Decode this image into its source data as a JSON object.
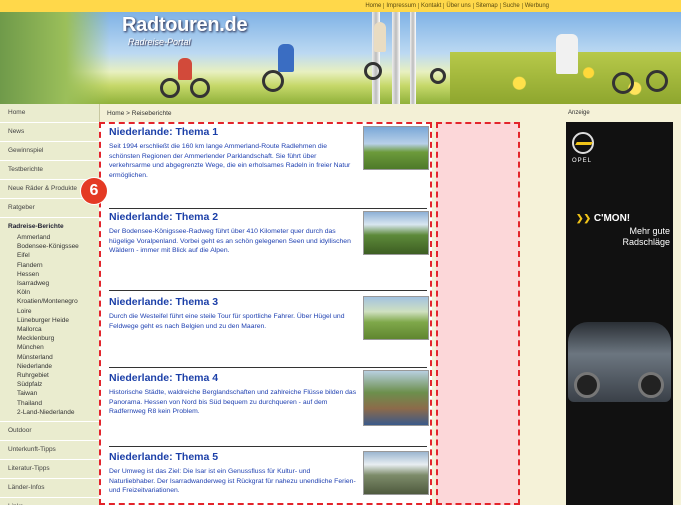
{
  "topnav": [
    "Home",
    "Impressum",
    "Kontakt",
    "Über uns",
    "Sitemap",
    "Suche",
    "Werbung"
  ],
  "header": {
    "logo": "Radtouren.de",
    "tagline": "Radreise-Portal"
  },
  "sidebar": {
    "items_top": [
      "Home",
      "News",
      "Gewinnspiel",
      "Testberichte",
      "Neue Räder & Produkte",
      "Ratgeber"
    ],
    "active_section": "Radreise-Berichte",
    "sub_items": [
      "Ammerland",
      "Bodensee-Königssee",
      "Eifel",
      "Flandern",
      "Hessen",
      "Isarradweg",
      "Köln",
      "Kroatien/Montenegro",
      "Loire",
      "Lüneburger Heide",
      "Mallorca",
      "Mecklenburg",
      "München",
      "Münsterland",
      "Niederlande",
      "Ruhrgebiet",
      "Südpfalz",
      "Taiwan",
      "Thailand",
      "2-Land-Niederlande"
    ],
    "items_bottom": [
      "Outdoor",
      "Unterkunft-Tipps",
      "Literatur-Tipps",
      "Länder-Infos",
      "Links"
    ]
  },
  "breadcrumb": "Home > Reiseberichte",
  "badge": "6",
  "articles": [
    {
      "title": "Niederlande: Thema 1",
      "text": "Seit 1994 erschließt die 160 km lange Ammerland-Route Radlehmen die schönsten Regionen der Ammerlender Parklandschaft. Sie führt über verkehrsarme und abgegrenzte Wege, die ein erholsames Radeln in freier Natur ermöglichen."
    },
    {
      "title": "Niederlande: Thema 2",
      "text": "Der Bodensee-Königssee-Radweg führt über 410 Kilometer quer durch das hügelige Voralpenland. Vorbei geht es an schön gelegenen Seen und idyllischen Wäldern - immer mit Blick auf die Alpen."
    },
    {
      "title": "Niederlande: Thema 3",
      "text": "Durch die Westeifel führt eine steile Tour für sportliche Fahrer. Über Hügel und Feldwege geht es nach Belgien und zu den Maaren."
    },
    {
      "title": "Niederlande: Thema 4",
      "text": "Historische Städte, waldreiche Berglandschaften und zahlreiche Flüsse bilden das Panorama. Hessen von Nord bis Süd bequem zu durchqueren - auf dem Radfernweg R8 kein Problem."
    },
    {
      "title": "Niederlande: Thema 5",
      "text": "Der Umweg ist das Ziel: Die Isar ist ein Genussfluss für Kultur- und Naturliebhaber. Der Isarradwanderweg ist Rückgrat für nahezu unendliche Ferien- und Freizeitvariationen."
    }
  ],
  "ad": {
    "label": "Anzeige",
    "brand": "OPEL",
    "headline": "C'MON!",
    "subline": "Mehr gute Radschläge"
  },
  "colors": {
    "link_blue": "#1b3fa8",
    "highlight_red": "#e3242b",
    "badge_red": "#e43a24",
    "topnav_yellow": "#ffd84a"
  }
}
